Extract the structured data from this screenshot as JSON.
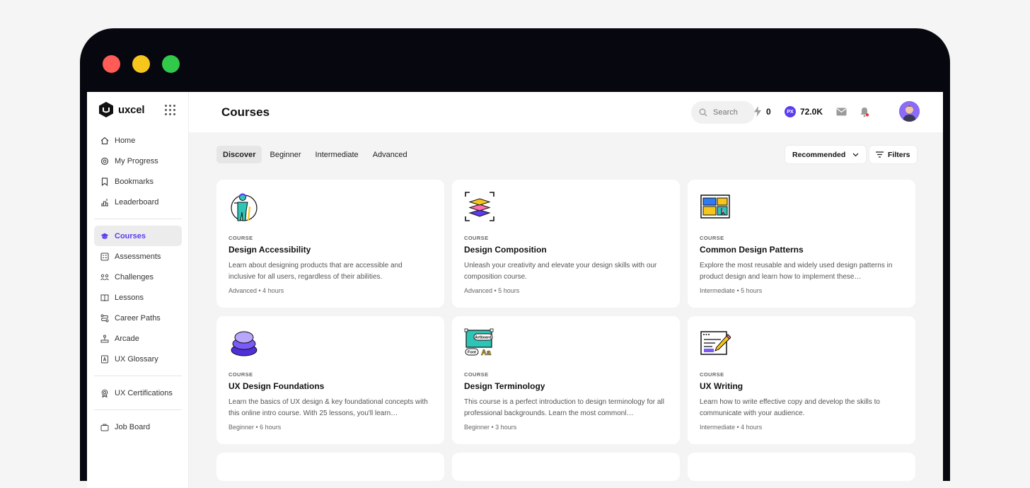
{
  "app": {
    "logo_text": "uxcel"
  },
  "sidebar": {
    "items": [
      {
        "label": "Home",
        "icon": "home-icon"
      },
      {
        "label": "My Progress",
        "icon": "progress-gear-icon"
      },
      {
        "label": "Bookmarks",
        "icon": "bookmark-icon"
      },
      {
        "label": "Leaderboard",
        "icon": "leaderboard-icon"
      },
      {
        "label": "Courses",
        "icon": "graduation-cap-icon",
        "active": true
      },
      {
        "label": "Assessments",
        "icon": "assessment-icon"
      },
      {
        "label": "Challenges",
        "icon": "challenge-icon"
      },
      {
        "label": "Lessons",
        "icon": "book-icon"
      },
      {
        "label": "Career Paths",
        "icon": "path-icon"
      },
      {
        "label": "Arcade",
        "icon": "joystick-icon"
      },
      {
        "label": "UX Glossary",
        "icon": "glossary-icon"
      },
      {
        "label": "UX Certifications",
        "icon": "certificate-icon"
      },
      {
        "label": "Job Board",
        "icon": "briefcase-icon"
      }
    ]
  },
  "header": {
    "title": "Courses",
    "search_placeholder": "Search",
    "streak": "0",
    "xp": "72.0K",
    "xp_badge": "PX"
  },
  "tabs": [
    {
      "label": "Discover",
      "active": true
    },
    {
      "label": "Beginner"
    },
    {
      "label": "Intermediate"
    },
    {
      "label": "Advanced"
    }
  ],
  "sort": {
    "label": "Recommended"
  },
  "filters": {
    "label": "Filters"
  },
  "courses": [
    {
      "kicker": "COURSE",
      "title": "Design Accessibility",
      "desc": "Learn about designing products that are accessible and inclusive for all users, regardless of their abilities.",
      "meta": "Advanced • 4 hours"
    },
    {
      "kicker": "COURSE",
      "title": "Design Composition",
      "desc": "Unleash your creativity and elevate your design skills with our composition course.",
      "meta": "Advanced • 5 hours"
    },
    {
      "kicker": "COURSE",
      "title": "Common Design Patterns",
      "desc": "Explore the most reusable and widely used design patterns in product design and learn how to implement these…",
      "meta": "Intermediate • 5 hours"
    },
    {
      "kicker": "COURSE",
      "title": "UX Design Foundations",
      "desc": "Learn the basics of UX design & key foundational concepts with this online intro course. With 25 lessons, you'll learn…",
      "meta": "Beginner • 6 hours"
    },
    {
      "kicker": "COURSE",
      "title": "Design Terminology",
      "desc": "This course is a perfect introduction to design terminology for all professional backgrounds. Learn the most commonl…",
      "meta": "Beginner • 3 hours"
    },
    {
      "kicker": "COURSE",
      "title": "UX Writing",
      "desc": "Learn how to write effective copy and develop the skills to communicate with your audience.",
      "meta": "Intermediate • 4 hours"
    }
  ],
  "illustration_labels": {
    "artboard": "Artboard",
    "font": "Font",
    "aa": "Aa"
  },
  "colors": {
    "accent": "#5b3cf0",
    "device_frame": "#07070f"
  }
}
